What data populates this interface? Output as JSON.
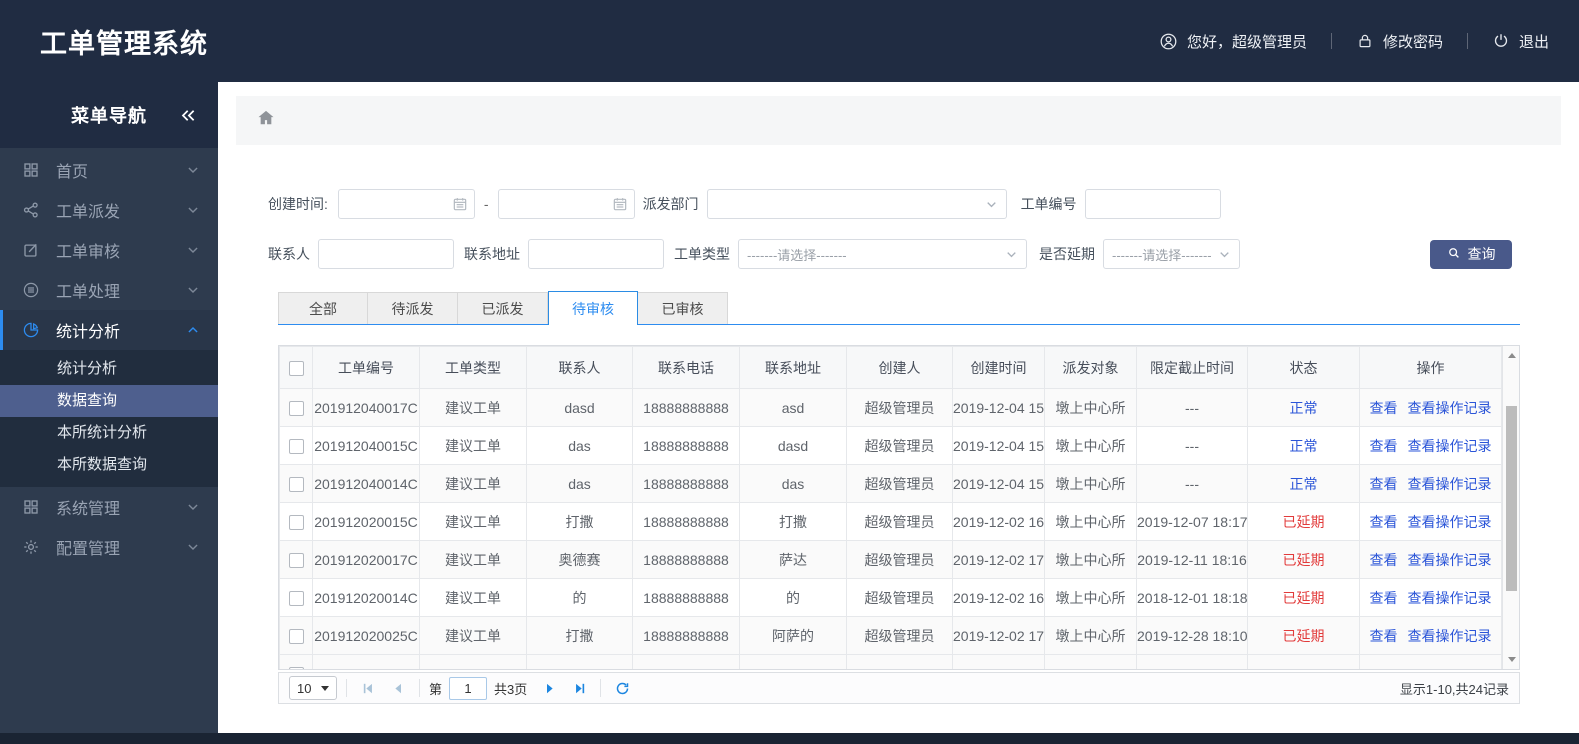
{
  "app": {
    "title": "工单管理系统"
  },
  "header": {
    "greeting": "您好，超级管理员",
    "change_password": "修改密码",
    "logout": "退出"
  },
  "sidebar": {
    "title": "菜单导航",
    "items": [
      {
        "label": "首页",
        "icon": "grid-icon"
      },
      {
        "label": "工单派发",
        "icon": "share-icon"
      },
      {
        "label": "工单审核",
        "icon": "edit-icon"
      },
      {
        "label": "工单处理",
        "icon": "process-icon"
      },
      {
        "label": "统计分析",
        "icon": "pie-chart-icon",
        "active": true
      },
      {
        "label": "系统管理",
        "icon": "apps-icon"
      },
      {
        "label": "配置管理",
        "icon": "gear-icon"
      }
    ],
    "submenu": {
      "items": [
        "统计分析",
        "数据查询",
        "本所统计分析",
        "本所数据查询"
      ],
      "selected": "数据查询"
    }
  },
  "filters": {
    "create_time_label": "创建时间:",
    "range_separator": "-",
    "dispatch_dept_label": "派发部门",
    "order_no_label": "工单编号",
    "contact_label": "联系人",
    "address_label": "联系地址",
    "order_type_label": "工单类型",
    "order_type_placeholder": "-------请选择-------",
    "delay_label": "是否延期",
    "delay_placeholder": "-------请选择-------",
    "search_button": "查询"
  },
  "tabs": {
    "items": [
      "全部",
      "待派发",
      "已派发",
      "待审核",
      "已审核"
    ],
    "active": "待审核"
  },
  "table": {
    "columns": [
      "工单编号",
      "工单类型",
      "联系人",
      "联系电话",
      "联系地址",
      "创建人",
      "创建时间",
      "派发对象",
      "限定截止时间",
      "状态",
      "操作"
    ],
    "action_labels": [
      "查看",
      "查看操作记录"
    ],
    "rows": [
      {
        "order_no": "201912040017C",
        "type": "建议工单",
        "contact": "dasd",
        "phone": "18888888888",
        "address": "asd",
        "creator": "超级管理员",
        "created": "2019-12-04 15",
        "target": "墩上中心所",
        "deadline": "---",
        "status": "正常",
        "status_type": "normal"
      },
      {
        "order_no": "201912040015C",
        "type": "建议工单",
        "contact": "das",
        "phone": "18888888888",
        "address": "dasd",
        "creator": "超级管理员",
        "created": "2019-12-04 15",
        "target": "墩上中心所",
        "deadline": "---",
        "status": "正常",
        "status_type": "normal"
      },
      {
        "order_no": "201912040014C",
        "type": "建议工单",
        "contact": "das",
        "phone": "18888888888",
        "address": "das",
        "creator": "超级管理员",
        "created": "2019-12-04 15",
        "target": "墩上中心所",
        "deadline": "---",
        "status": "正常",
        "status_type": "normal"
      },
      {
        "order_no": "201912020015C",
        "type": "建议工单",
        "contact": "打撒",
        "phone": "18888888888",
        "address": "打撒",
        "creator": "超级管理员",
        "created": "2019-12-02 16",
        "target": "墩上中心所",
        "deadline": "2019-12-07 18:17",
        "status": "已延期",
        "status_type": "delayed"
      },
      {
        "order_no": "201912020017C",
        "type": "建议工单",
        "contact": "奥德赛",
        "phone": "18888888888",
        "address": "萨达",
        "creator": "超级管理员",
        "created": "2019-12-02 17",
        "target": "墩上中心所",
        "deadline": "2019-12-11 18:16",
        "status": "已延期",
        "status_type": "delayed"
      },
      {
        "order_no": "201912020014C",
        "type": "建议工单",
        "contact": "的",
        "phone": "18888888888",
        "address": "的",
        "creator": "超级管理员",
        "created": "2019-12-02 16",
        "target": "墩上中心所",
        "deadline": "2018-12-01 18:18",
        "status": "已延期",
        "status_type": "delayed"
      },
      {
        "order_no": "201912020025C",
        "type": "建议工单",
        "contact": "打撒",
        "phone": "18888888888",
        "address": "阿萨的",
        "creator": "超级管理员",
        "created": "2019-12-02 17",
        "target": "墩上中心所",
        "deadline": "2019-12-28 18:10",
        "status": "已延期",
        "status_type": "delayed"
      }
    ]
  },
  "pagination": {
    "page_size": "10",
    "page_prefix": "第",
    "page_value": "1",
    "total_pages": "共3页",
    "summary": "显示1-10,共24记录"
  },
  "icons": {
    "header": [
      "user-icon",
      "lock-icon",
      "power-icon"
    ],
    "breadcrumb": "home-icon",
    "inputs": [
      "calendar-icon",
      "chevron-down-icon",
      "search-icon"
    ],
    "pagination": [
      "first-page-icon",
      "prev-page-icon",
      "next-page-icon",
      "last-page-icon",
      "refresh-icon"
    ]
  },
  "colors": {
    "header_bg": "#202c42",
    "sidebar_bg": "#2e3b4e",
    "accent_blue": "#2d8cf0",
    "link_blue": "#2b55d8",
    "danger_red": "#e23b3b",
    "search_button": "#49598a",
    "selected_submenu": "#4e5f8e"
  }
}
